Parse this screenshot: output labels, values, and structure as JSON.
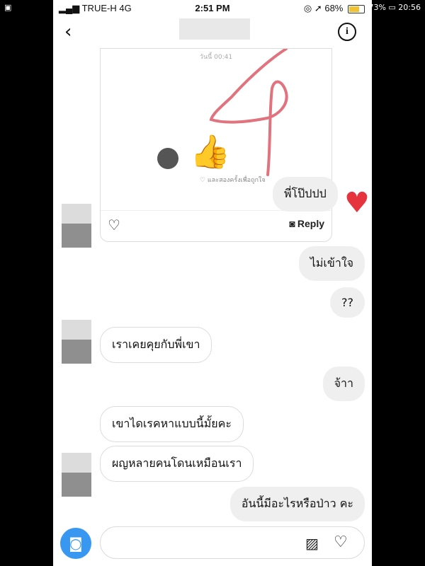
{
  "outer_status": {
    "left": "▣",
    "right": "✱ 73% ▭ 20:56"
  },
  "status": {
    "carrier": "TRUE-H",
    "network": "4G",
    "time": "2:51 PM",
    "icons": "◎ ➚",
    "battery_text": "68%",
    "battery_level": 0.68,
    "battery_color": "#f1c232"
  },
  "header": {
    "back_icon": "‹",
    "info_icon": "i"
  },
  "story": {
    "time": "วันนี้ 00:41",
    "thumb": "👍",
    "subtext": "♡ และสองครั้งเพื่อถูกใจ",
    "heart": "♥",
    "reply_bubble": "พี่โป๊ปปป",
    "footer_heart": "♡",
    "footer_cam": "◙",
    "footer_reply": "Reply"
  },
  "messages": [
    {
      "text": "ไม่เข้าใจ",
      "side": "out"
    },
    {
      "text": "??",
      "side": "out"
    },
    {
      "text": "เราเคยคุยกับพี่เขา",
      "side": "in"
    },
    {
      "text": "จ้าา",
      "side": "out"
    },
    {
      "text": "เขาไดเรคหาแบบนี้มั้ยคะ",
      "side": "in"
    },
    {
      "text": "ผญหลายคนโดนเหมือนเรา",
      "side": "in"
    },
    {
      "text": "อันนี้มีอะไรหรือป่าว คะ",
      "side": "out"
    }
  ],
  "composer": {
    "camera_icon": "◙",
    "gallery_icon": "▨",
    "heart_icon": "♡",
    "placeholder": ""
  },
  "colors": {
    "accent": "#3897f0",
    "scribble": "#e0737d",
    "heart": "#e5343d"
  }
}
